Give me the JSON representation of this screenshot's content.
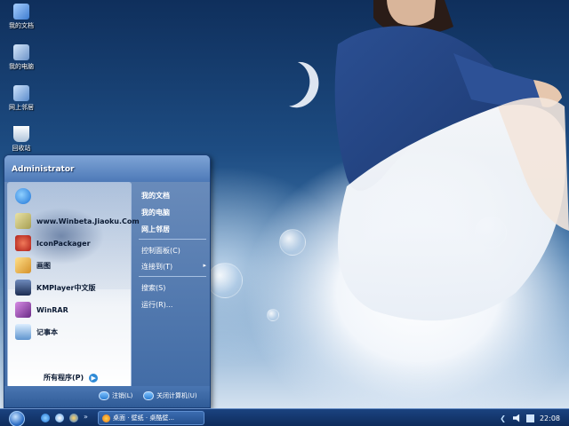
{
  "desktop": {
    "icons": [
      {
        "label": "我的文档",
        "icon": "documents-folder-icon",
        "color": "#5b9be0"
      },
      {
        "label": "我的电脑",
        "icon": "computer-icon",
        "color": "#8fb4de"
      },
      {
        "label": "网上邻居",
        "icon": "network-icon",
        "color": "#6ca0d6"
      },
      {
        "label": "回收站",
        "icon": "recycle-bin-icon",
        "color": "#e9eef5"
      }
    ]
  },
  "start_menu": {
    "user_name": "Administrator",
    "programs": [
      {
        "label": "",
        "icon": "internet-explorer-icon",
        "color": "#1e73d6"
      },
      {
        "label": "www.Winbeta.Jiaoku.Com",
        "icon": "sfc-app-icon",
        "color": "#c9c27a"
      },
      {
        "label": "IconPackager",
        "icon": "iconpackager-icon",
        "color": "#c0302a"
      },
      {
        "label": "画图",
        "icon": "paint-icon",
        "color": "#e6b640"
      },
      {
        "label": "KMPlayer中文版",
        "icon": "kmplayer-icon",
        "color": "#2a3f6a"
      },
      {
        "label": "WinRAR",
        "icon": "winrar-icon",
        "color": "#8a3fa0"
      },
      {
        "label": "记事本",
        "icon": "notepad-icon",
        "color": "#6fa3d8"
      }
    ],
    "all_programs": "所有程序(P)",
    "right": {
      "my_documents": "我的文档",
      "my_computer": "我的电脑",
      "network": "网上邻居",
      "control_panel": "控制面板(C)",
      "connect_to": "连接到(T)",
      "search": "搜索(S)",
      "run": "运行(R)..."
    },
    "footer": {
      "logoff": "注销(L)",
      "shutdown": "关闭计算机(U)"
    }
  },
  "taskbar": {
    "task_label": "桌面 · 壁纸 · 桌酷壁...",
    "clock": "22:08"
  }
}
